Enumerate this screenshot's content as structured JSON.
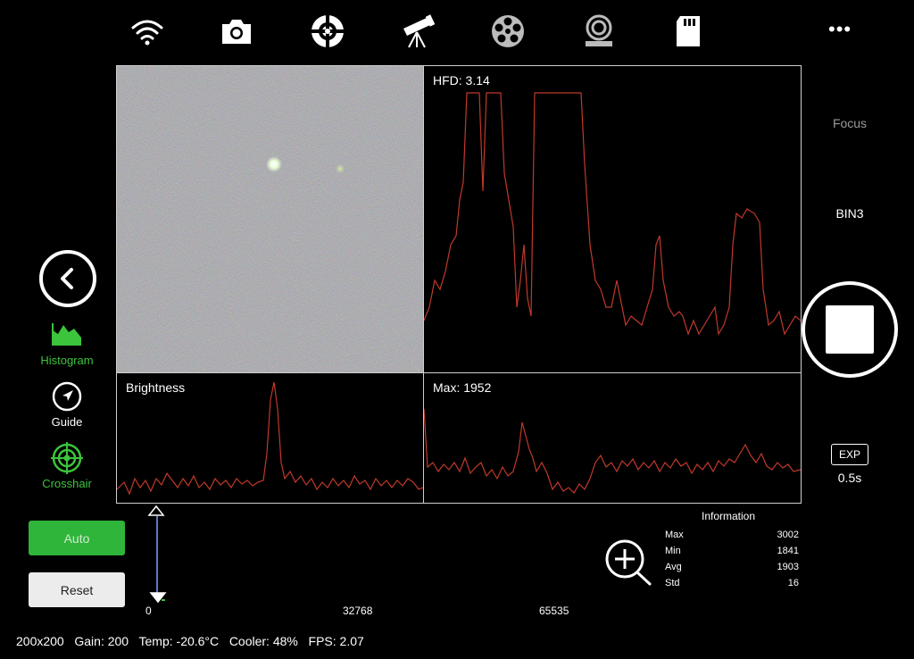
{
  "toolbar": {
    "icons": [
      "wifi-icon",
      "camera-icon",
      "crosshair-target-icon",
      "telescope-icon",
      "filter-wheel-icon",
      "focuser-icon",
      "sd-card-icon"
    ],
    "more_label": "•••"
  },
  "right_panel": {
    "mode_label": "Focus",
    "bin_label": "BIN3",
    "exp_badge": "EXP",
    "exp_value": "0.5s"
  },
  "left_panel": {
    "tools": [
      {
        "label": "Histogram",
        "color": "#3cc43c"
      },
      {
        "label": "Guide",
        "color": "#ffffff"
      },
      {
        "label": "Crosshair",
        "color": "#3cc43c"
      }
    ],
    "auto_label": "Auto",
    "reset_label": "Reset",
    "accent": "#2fb53a"
  },
  "panels": {
    "hfd_label": "HFD: 3.14",
    "brightness_label": "Brightness",
    "max_label": "Max: 1952"
  },
  "histogram": {
    "ticks": [
      "0",
      "32768",
      "65535"
    ]
  },
  "information": {
    "title": "Information",
    "rows": [
      {
        "key": "Max",
        "value": "3002"
      },
      {
        "key": "Min",
        "value": "1841"
      },
      {
        "key": "Avg",
        "value": "1903"
      },
      {
        "key": "Std",
        "value": "16"
      }
    ]
  },
  "status_bar": {
    "text": "200x200   Gain: 200   Temp: -20.6°C   Cooler: 48%   FPS: 2.07"
  },
  "colors": {
    "plot_line": "#c0392b",
    "panel_border": "#cfcfcf"
  }
}
